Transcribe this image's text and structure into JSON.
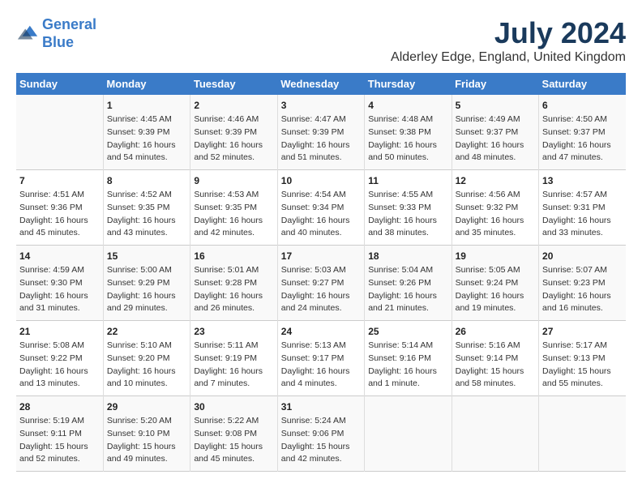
{
  "header": {
    "logo_line1": "General",
    "logo_line2": "Blue",
    "month_year": "July 2024",
    "location": "Alderley Edge, England, United Kingdom"
  },
  "columns": [
    "Sunday",
    "Monday",
    "Tuesday",
    "Wednesday",
    "Thursday",
    "Friday",
    "Saturday"
  ],
  "weeks": [
    [
      {
        "day": "",
        "info": ""
      },
      {
        "day": "1",
        "info": "Sunrise: 4:45 AM\nSunset: 9:39 PM\nDaylight: 16 hours\nand 54 minutes."
      },
      {
        "day": "2",
        "info": "Sunrise: 4:46 AM\nSunset: 9:39 PM\nDaylight: 16 hours\nand 52 minutes."
      },
      {
        "day": "3",
        "info": "Sunrise: 4:47 AM\nSunset: 9:39 PM\nDaylight: 16 hours\nand 51 minutes."
      },
      {
        "day": "4",
        "info": "Sunrise: 4:48 AM\nSunset: 9:38 PM\nDaylight: 16 hours\nand 50 minutes."
      },
      {
        "day": "5",
        "info": "Sunrise: 4:49 AM\nSunset: 9:37 PM\nDaylight: 16 hours\nand 48 minutes."
      },
      {
        "day": "6",
        "info": "Sunrise: 4:50 AM\nSunset: 9:37 PM\nDaylight: 16 hours\nand 47 minutes."
      }
    ],
    [
      {
        "day": "7",
        "info": "Sunrise: 4:51 AM\nSunset: 9:36 PM\nDaylight: 16 hours\nand 45 minutes."
      },
      {
        "day": "8",
        "info": "Sunrise: 4:52 AM\nSunset: 9:35 PM\nDaylight: 16 hours\nand 43 minutes."
      },
      {
        "day": "9",
        "info": "Sunrise: 4:53 AM\nSunset: 9:35 PM\nDaylight: 16 hours\nand 42 minutes."
      },
      {
        "day": "10",
        "info": "Sunrise: 4:54 AM\nSunset: 9:34 PM\nDaylight: 16 hours\nand 40 minutes."
      },
      {
        "day": "11",
        "info": "Sunrise: 4:55 AM\nSunset: 9:33 PM\nDaylight: 16 hours\nand 38 minutes."
      },
      {
        "day": "12",
        "info": "Sunrise: 4:56 AM\nSunset: 9:32 PM\nDaylight: 16 hours\nand 35 minutes."
      },
      {
        "day": "13",
        "info": "Sunrise: 4:57 AM\nSunset: 9:31 PM\nDaylight: 16 hours\nand 33 minutes."
      }
    ],
    [
      {
        "day": "14",
        "info": "Sunrise: 4:59 AM\nSunset: 9:30 PM\nDaylight: 16 hours\nand 31 minutes."
      },
      {
        "day": "15",
        "info": "Sunrise: 5:00 AM\nSunset: 9:29 PM\nDaylight: 16 hours\nand 29 minutes."
      },
      {
        "day": "16",
        "info": "Sunrise: 5:01 AM\nSunset: 9:28 PM\nDaylight: 16 hours\nand 26 minutes."
      },
      {
        "day": "17",
        "info": "Sunrise: 5:03 AM\nSunset: 9:27 PM\nDaylight: 16 hours\nand 24 minutes."
      },
      {
        "day": "18",
        "info": "Sunrise: 5:04 AM\nSunset: 9:26 PM\nDaylight: 16 hours\nand 21 minutes."
      },
      {
        "day": "19",
        "info": "Sunrise: 5:05 AM\nSunset: 9:24 PM\nDaylight: 16 hours\nand 19 minutes."
      },
      {
        "day": "20",
        "info": "Sunrise: 5:07 AM\nSunset: 9:23 PM\nDaylight: 16 hours\nand 16 minutes."
      }
    ],
    [
      {
        "day": "21",
        "info": "Sunrise: 5:08 AM\nSunset: 9:22 PM\nDaylight: 16 hours\nand 13 minutes."
      },
      {
        "day": "22",
        "info": "Sunrise: 5:10 AM\nSunset: 9:20 PM\nDaylight: 16 hours\nand 10 minutes."
      },
      {
        "day": "23",
        "info": "Sunrise: 5:11 AM\nSunset: 9:19 PM\nDaylight: 16 hours\nand 7 minutes."
      },
      {
        "day": "24",
        "info": "Sunrise: 5:13 AM\nSunset: 9:17 PM\nDaylight: 16 hours\nand 4 minutes."
      },
      {
        "day": "25",
        "info": "Sunrise: 5:14 AM\nSunset: 9:16 PM\nDaylight: 16 hours\nand 1 minute."
      },
      {
        "day": "26",
        "info": "Sunrise: 5:16 AM\nSunset: 9:14 PM\nDaylight: 15 hours\nand 58 minutes."
      },
      {
        "day": "27",
        "info": "Sunrise: 5:17 AM\nSunset: 9:13 PM\nDaylight: 15 hours\nand 55 minutes."
      }
    ],
    [
      {
        "day": "28",
        "info": "Sunrise: 5:19 AM\nSunset: 9:11 PM\nDaylight: 15 hours\nand 52 minutes."
      },
      {
        "day": "29",
        "info": "Sunrise: 5:20 AM\nSunset: 9:10 PM\nDaylight: 15 hours\nand 49 minutes."
      },
      {
        "day": "30",
        "info": "Sunrise: 5:22 AM\nSunset: 9:08 PM\nDaylight: 15 hours\nand 45 minutes."
      },
      {
        "day": "31",
        "info": "Sunrise: 5:24 AM\nSunset: 9:06 PM\nDaylight: 15 hours\nand 42 minutes."
      },
      {
        "day": "",
        "info": ""
      },
      {
        "day": "",
        "info": ""
      },
      {
        "day": "",
        "info": ""
      }
    ]
  ]
}
